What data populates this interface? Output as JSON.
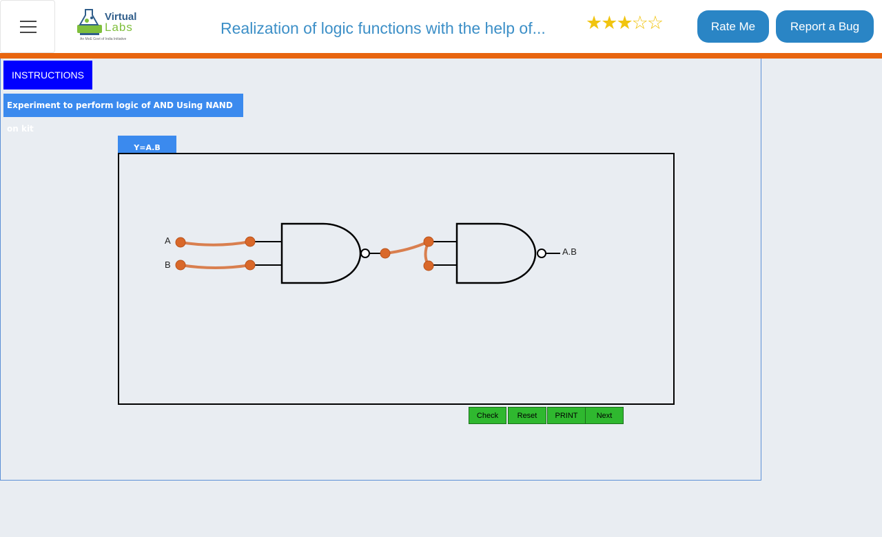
{
  "header": {
    "logo_virtual": "Virtual",
    "logo_labs": "Labs",
    "logo_tagline": "An MoE Govt of India Initiative",
    "title": "Realization of logic functions with the help of...",
    "rating": {
      "filled": 3,
      "total": 5
    },
    "rate_me_label": "Rate Me",
    "report_bug_label": "Report a Bug"
  },
  "workspace": {
    "instructions_label": "INSTRUCTIONS",
    "experiment_label": "Experiment to perform logic of AND Using NAND on kit",
    "tab_label": "Y=A.B",
    "circuit": {
      "input_a_label": "A",
      "input_b_label": "B",
      "output_label": "A.B"
    },
    "controls": {
      "check_label": "Check",
      "reset_label": "Reset",
      "print_label": "PRINT",
      "next_label": "Next"
    }
  },
  "colors": {
    "accent": "#2a85c5",
    "orange_bar": "#e8650f",
    "wire": "#d97f4f",
    "terminal": "#d9682a",
    "control_green": "#2fb82f",
    "instructions_blue": "#0000ff"
  }
}
